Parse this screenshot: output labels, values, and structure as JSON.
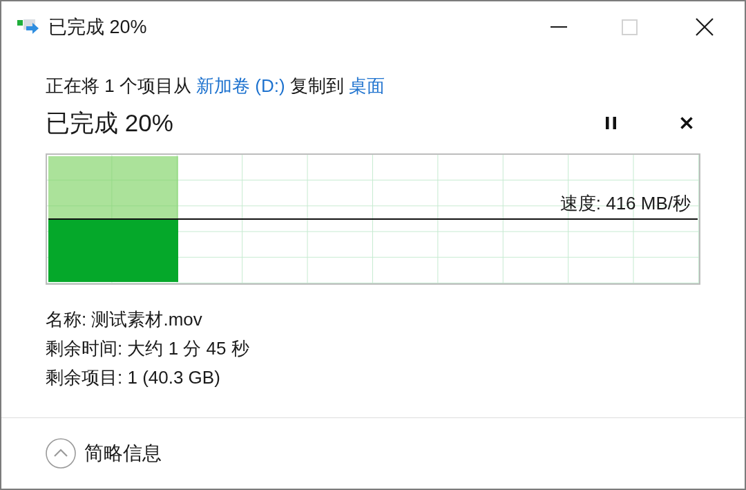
{
  "window": {
    "title": "已完成 20%"
  },
  "window_controls": [
    {
      "kind": "minimize",
      "disabled": false
    },
    {
      "kind": "maximize",
      "disabled": true
    },
    {
      "kind": "close",
      "disabled": false
    }
  ],
  "summary": [
    {
      "kind": "text",
      "text": "正在将 1 个项目从 "
    },
    {
      "kind": "link",
      "text": "新加卷 (D:)"
    },
    {
      "kind": "text",
      "text": " 复制到 "
    },
    {
      "kind": "link",
      "text": "桌面"
    }
  ],
  "progress": {
    "heading": "已完成 20%",
    "level": 0.2,
    "speed": "速度: 416 MB/秒"
  },
  "actions": [
    {
      "kind": "pause"
    },
    {
      "kind": "cancel"
    }
  ],
  "details": [
    "名称: 测试素材.mov",
    "剩余时间: 大约 1 分 45 秒",
    "剩余项目: 1 (40.3 GB)"
  ],
  "footer": {
    "toggle": {
      "label": "简略信息",
      "expanded": true
    }
  }
}
